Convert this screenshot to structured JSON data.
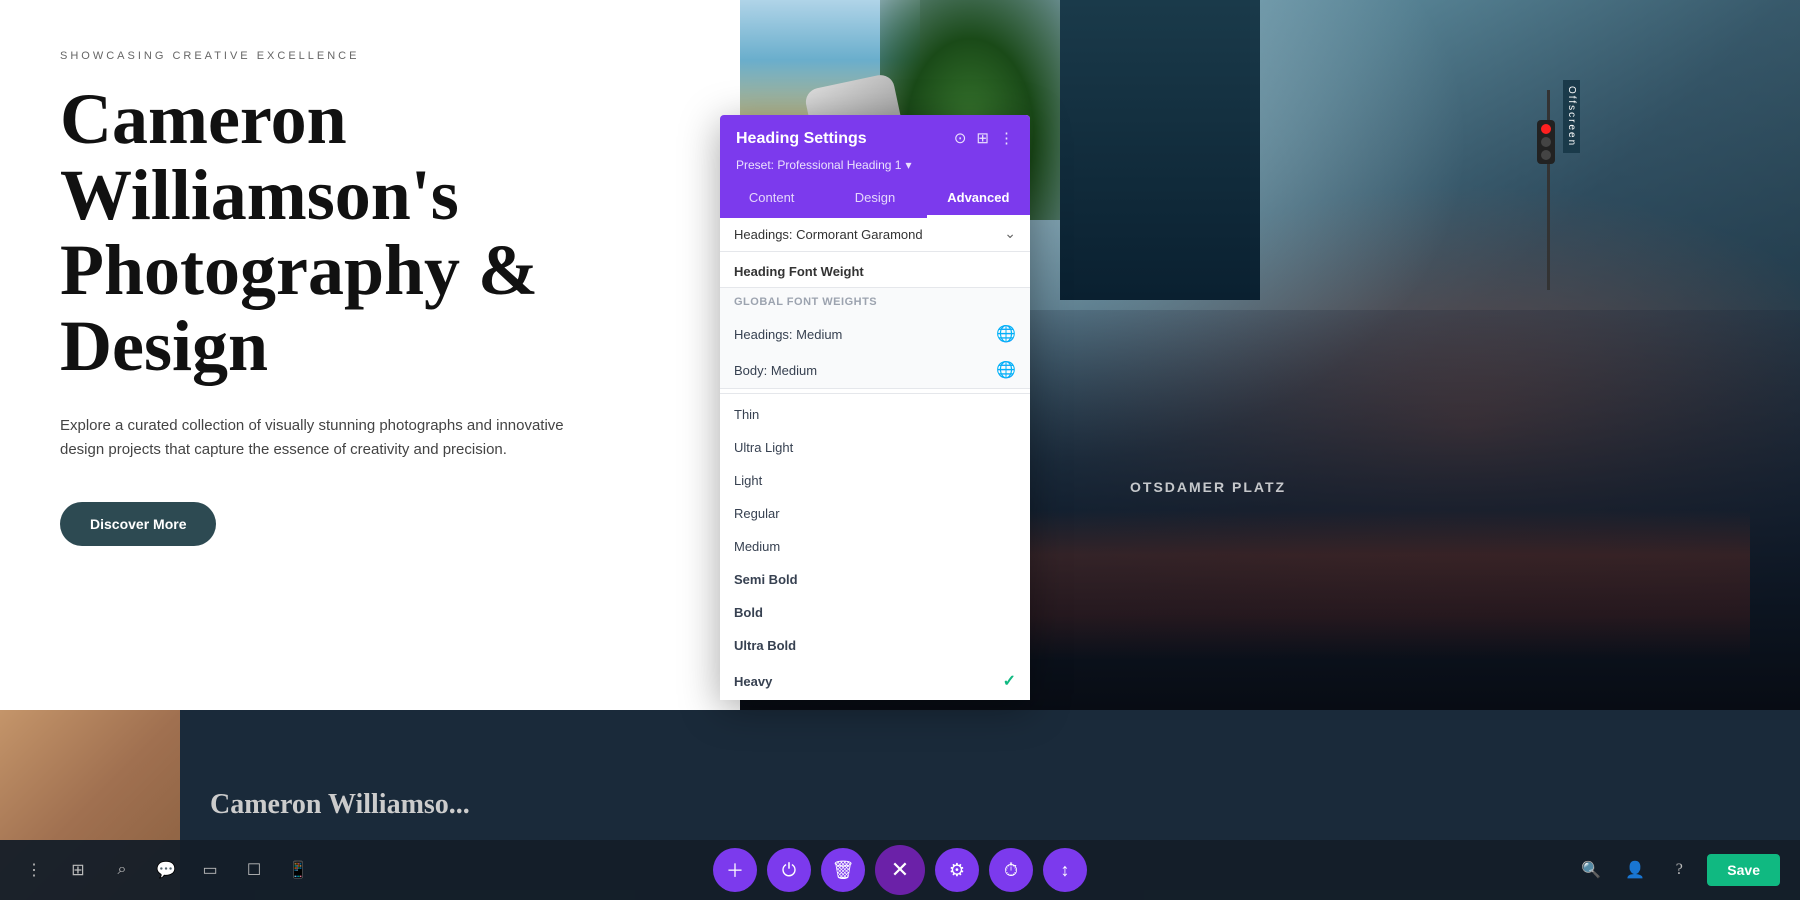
{
  "hero": {
    "subtitle": "SHOWCASING CREATIVE EXCELLENCE",
    "heading_line1": "Cameron",
    "heading_line2": "Williamson's",
    "heading_line3": "Photography &",
    "heading_line4": "Design",
    "description": "Explore a curated collection of visually stunning photographs and innovative design projects that capture the essence of creativity and precision.",
    "discover_btn": "Discover More",
    "offscreen": "Offscreen",
    "billboard": "OTSDAMER PLATZ"
  },
  "bottom_bar_text": "Cameron Williamso...",
  "toolbar": {
    "left_icons": [
      "⋮",
      "⊞",
      "⌕",
      "💬",
      "▭",
      "☐"
    ],
    "center_buttons": [
      {
        "icon": "+",
        "style": "tb-purple",
        "label": "add"
      },
      {
        "icon": "⏻",
        "style": "tb-purple",
        "label": "power"
      },
      {
        "icon": "🗑",
        "style": "tb-purple",
        "label": "trash"
      },
      {
        "icon": "✕",
        "style": "tb-close",
        "label": "close"
      },
      {
        "icon": "⚙",
        "style": "tb-purple",
        "label": "settings"
      },
      {
        "icon": "◷",
        "style": "tb-purple",
        "label": "history"
      },
      {
        "icon": "↕",
        "style": "tb-purple",
        "label": "move"
      }
    ],
    "right_icons": [
      "🔍",
      "👤",
      "?"
    ],
    "save_label": "Save"
  },
  "modal": {
    "title": "Heading Settings",
    "preset_label": "Preset: Professional Heading 1",
    "preset_chevron": "▾",
    "header_icons": [
      "⊙",
      "⊞",
      "⋮"
    ],
    "tabs": [
      {
        "label": "Content",
        "active": false
      },
      {
        "label": "Design",
        "active": false
      },
      {
        "label": "Advanced",
        "active": true
      }
    ],
    "font_selector": {
      "label": "Headings: Cormorant Garamond",
      "chevron": "⌃"
    },
    "section_heading": "Heading Font Weight",
    "global_section": {
      "header": "Global Font Weights",
      "items": [
        {
          "label": "Headings: Medium",
          "has_icon": true
        },
        {
          "label": "Body: Medium",
          "has_icon": true
        }
      ]
    },
    "weight_items": [
      {
        "label": "Thin",
        "weight": "100",
        "active": false
      },
      {
        "label": "Ultra Light",
        "weight": "200",
        "active": false
      },
      {
        "label": "Light",
        "weight": "300",
        "active": false
      },
      {
        "label": "Regular",
        "weight": "400",
        "active": false
      },
      {
        "label": "Medium",
        "weight": "500",
        "active": false
      },
      {
        "label": "Semi Bold",
        "weight": "600",
        "active": false
      },
      {
        "label": "Bold",
        "weight": "700",
        "active": false,
        "bold": true
      },
      {
        "label": "Ultra Bold",
        "weight": "800",
        "active": false,
        "bold": true
      },
      {
        "label": "Heavy",
        "weight": "900",
        "active": true,
        "bold": true
      }
    ]
  }
}
